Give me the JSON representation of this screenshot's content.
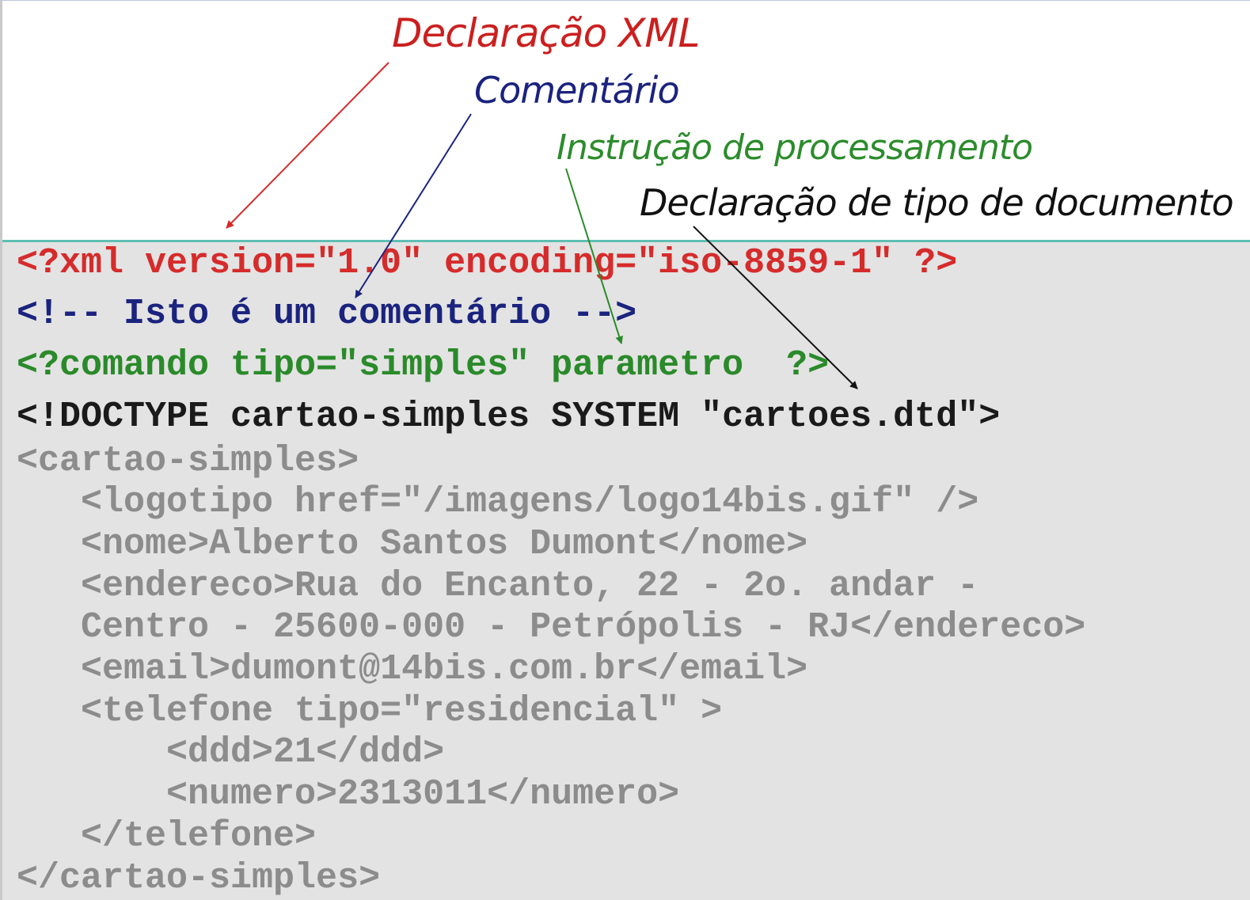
{
  "labels": {
    "xml_declaration": "Declaração XML",
    "comment": "Comentário",
    "processing_instruction": "Instrução de processamento",
    "doctype_declaration": "Declaração de tipo de documento"
  },
  "code_lines": [
    "<?xml version=\"1.0\" encoding=\"iso-8859-1\" ?>",
    "<!-- Isto é um comentário -->",
    "<?comando tipo=\"simples\" parametro  ?>",
    "<!DOCTYPE cartao-simples SYSTEM \"cartoes.dtd\">",
    "<cartao-simples>",
    "   <logotipo href=\"/imagens/logo14bis.gif\" />",
    "   <nome>Alberto Santos Dumont</nome>",
    "   <endereco>Rua do Encanto, 22 - 2o. andar -",
    "   Centro - 25600-000 - Petrópolis - RJ</endereco>",
    "   <email>dumont@14bis.com.br</email>",
    "   <telefone tipo=\"residencial\" >",
    "       <ddd>21</ddd>",
    "       <numero>2313011</numero>",
    "   </telefone>",
    "</cartao-simples>"
  ],
  "colors": {
    "xml_declaration": "#d62b2b",
    "comment": "#1a237e",
    "processing_instruction": "#2a8a2a",
    "doctype_declaration": "#1a1a1a",
    "body": "#8c8c8c",
    "panel_background": "#e3e3e3",
    "panel_top_border": "#5fbfb3"
  }
}
